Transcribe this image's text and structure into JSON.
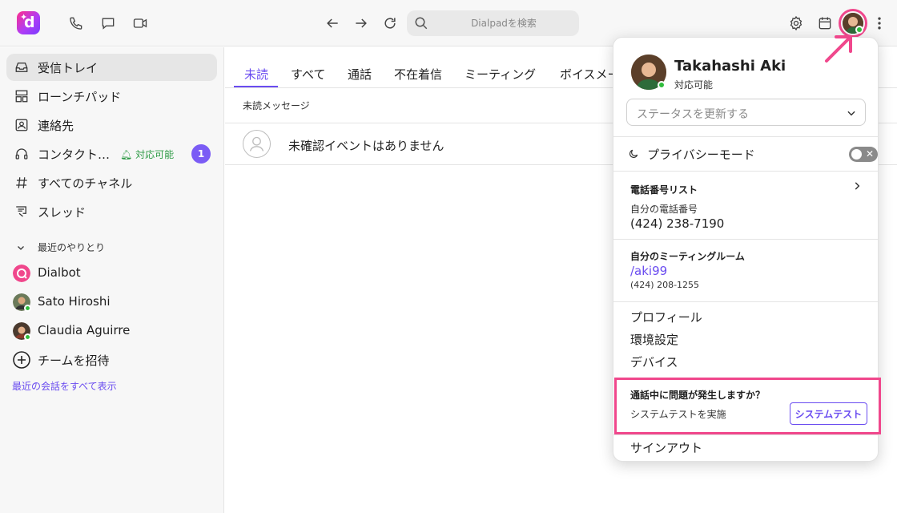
{
  "app": {
    "logo_letter": "d"
  },
  "search": {
    "placeholder": "Dialpadを検索"
  },
  "colors": {
    "accent": "#6a4cf0",
    "online": "#2fbd3c",
    "highlight": "#f0478c",
    "badge": "#7b5cf5"
  },
  "topbar_icons": [
    "phone-icon",
    "chat-icon",
    "video-icon",
    "back-icon",
    "forward-icon",
    "refresh-icon",
    "settings-icon",
    "calendar-icon",
    "more-icon"
  ],
  "sidebar": {
    "items": [
      {
        "label": "受信トレイ",
        "icon": "inbox-icon"
      },
      {
        "label": "ローンチパッド",
        "icon": "launchpad-icon"
      },
      {
        "label": "連絡先",
        "icon": "contacts-icon"
      },
      {
        "label": "コンタクト…",
        "icon": "headset-icon",
        "status": "対応可能",
        "badge": "1"
      },
      {
        "label": "すべてのチャネル",
        "icon": "hash-icon"
      },
      {
        "label": "スレッド",
        "icon": "thread-icon"
      }
    ],
    "recent_header": "最近のやりとり",
    "recent": [
      {
        "name": "Dialbot"
      },
      {
        "name": "Sato Hiroshi"
      },
      {
        "name": "Claudia Aguirre"
      }
    ],
    "invite_label": "チームを招待",
    "show_all": "最近の会話をすべて表示"
  },
  "main": {
    "tabs": [
      {
        "label": "未読"
      },
      {
        "label": "すべて"
      },
      {
        "label": "通話"
      },
      {
        "label": "不在着信"
      },
      {
        "label": "ミーティング"
      },
      {
        "label": "ボイスメール"
      }
    ],
    "list_header": "未読メッセージ",
    "empty_text": "未確認イベントはありません"
  },
  "panel": {
    "user_name": "Takahashi Aki",
    "user_status": "対応可能",
    "status_placeholder": "ステータスを更新する",
    "privacy_label": "プライバシーモード",
    "privacy_on": false,
    "phone_list_header": "電話番号リスト",
    "my_number_label": "自分の電話番号",
    "my_number": "(424) 238-7190",
    "meeting_header": "自分のミーティングルーム",
    "meeting_link": "/aki99",
    "meeting_number": "(424) 208-1255",
    "menu": [
      "プロフィール",
      "環境設定",
      "デバイス"
    ],
    "issue_header": "通話中に問題が発生しますか？",
    "issue_sub": "システムテストを実施",
    "issue_button": "システムテスト",
    "signout": "サインアウト"
  }
}
